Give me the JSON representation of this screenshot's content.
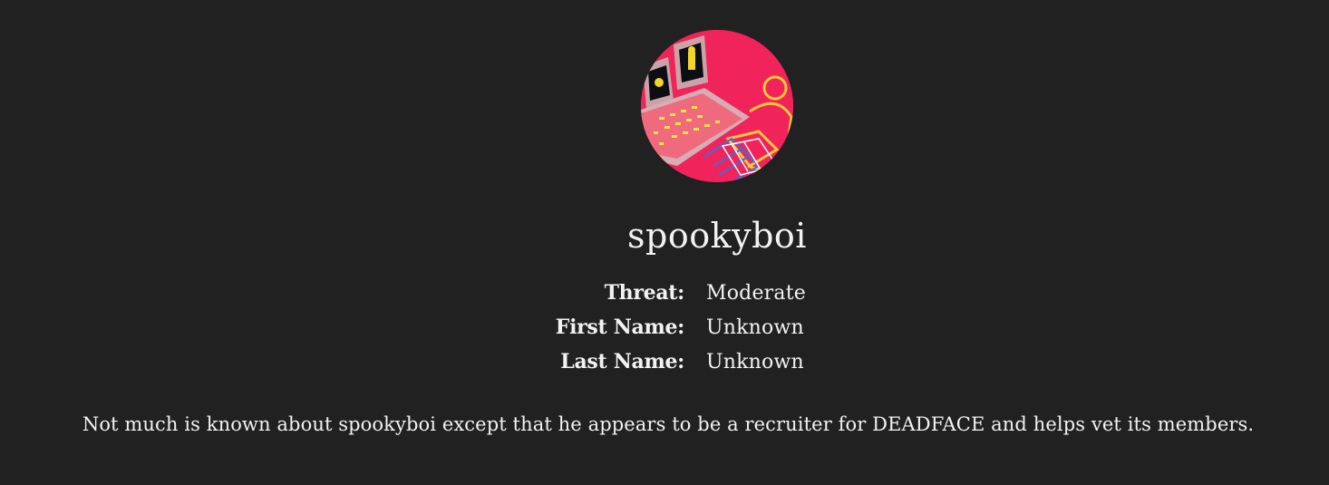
{
  "profile": {
    "avatar_icon": "retro-computer-console-avatar",
    "username": "spookyboi",
    "fields": [
      {
        "label": "Threat:",
        "value": "Moderate"
      },
      {
        "label": "First Name:",
        "value": "Unknown"
      },
      {
        "label": "Last Name:",
        "value": "Unknown"
      }
    ],
    "bio": "Not much is known about spookyboi except that he appears to be a recruiter for DEADFACE and helps vet its members."
  },
  "colors": {
    "background": "#212121",
    "text": "#f2f2f2",
    "avatar_bg": "#f0245a"
  }
}
